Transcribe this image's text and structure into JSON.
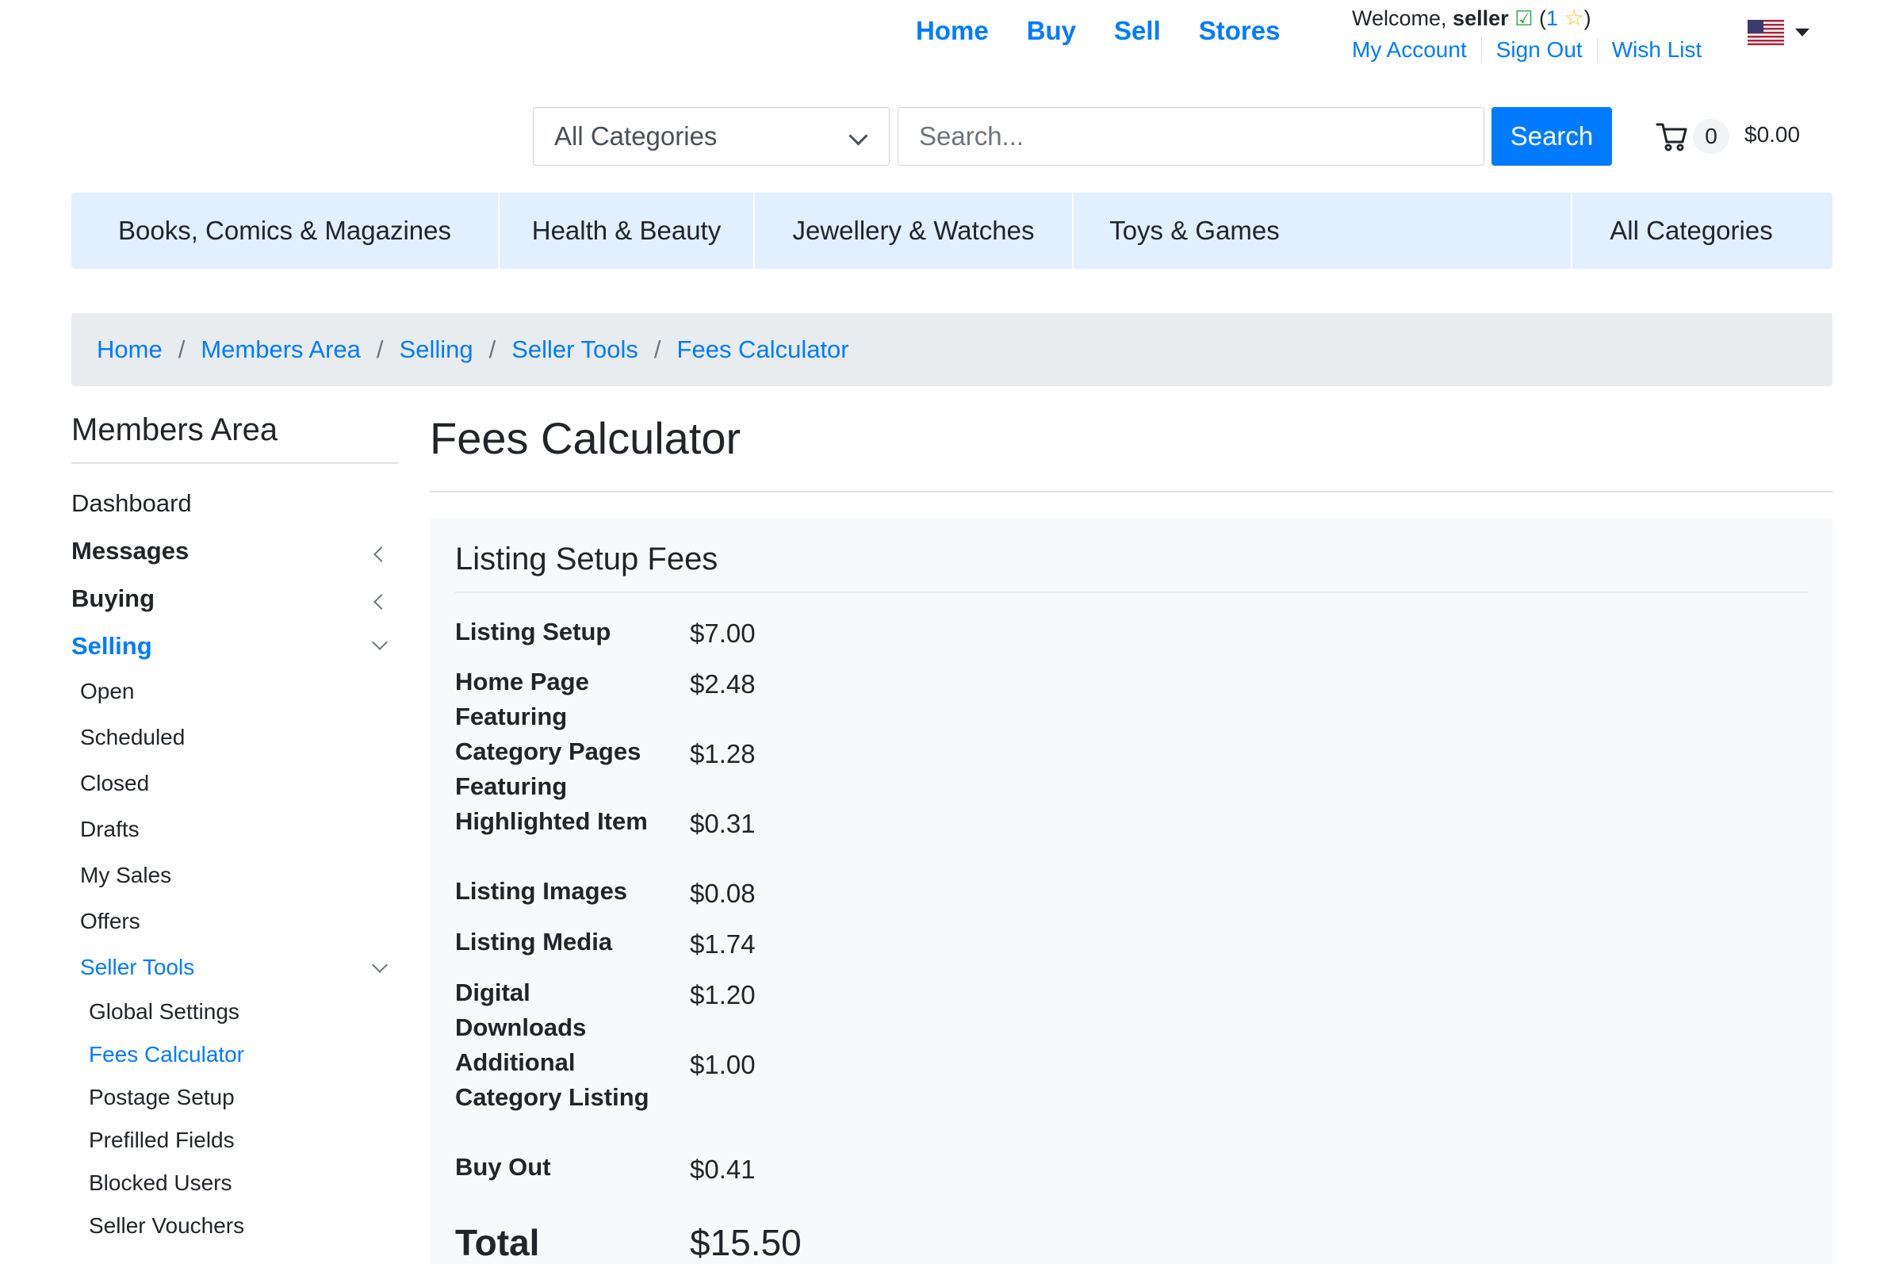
{
  "top_nav": [
    "Home",
    "Buy",
    "Sell",
    "Stores"
  ],
  "welcome": {
    "prefix": "Welcome, ",
    "username": "seller",
    "open_paren": "(",
    "rating": "1",
    "close_paren": ")"
  },
  "account_links": [
    "My Account",
    "Sign Out",
    "Wish List"
  ],
  "search": {
    "category": "All Categories",
    "placeholder": "Search...",
    "button": "Search"
  },
  "cart": {
    "count": "0",
    "total": "$0.00"
  },
  "category_bar": [
    "Books, Comics & Magazines",
    "Health & Beauty",
    "Jewellery & Watches",
    "Toys & Games",
    "All Categories"
  ],
  "breadcrumb": [
    "Home",
    "Members Area",
    "Selling",
    "Seller Tools",
    "Fees Calculator"
  ],
  "breadcrumb_separator": "/",
  "sidebar": {
    "title": "Members Area",
    "items": {
      "dashboard": "Dashboard",
      "messages": "Messages",
      "buying": "Buying",
      "selling": "Selling",
      "open": "Open",
      "scheduled": "Scheduled",
      "closed": "Closed",
      "drafts": "Drafts",
      "my_sales": "My Sales",
      "offers": "Offers",
      "seller_tools": "Seller Tools",
      "global_settings": "Global Settings",
      "fees_calculator": "Fees Calculator",
      "postage_setup": "Postage Setup",
      "prefilled_fields": "Prefilled Fields",
      "blocked_users": "Blocked Users",
      "seller_vouchers": "Seller Vouchers"
    }
  },
  "page": {
    "title": "Fees Calculator",
    "card_title": "Listing Setup Fees",
    "fees": [
      {
        "label": "Listing Setup",
        "value": "$7.00"
      },
      {
        "label": "Home Page Featuring",
        "value": "$2.48"
      },
      {
        "label": "Category Pages Featuring",
        "value": "$1.28"
      },
      {
        "label": "Highlighted Item",
        "value": "$0.31"
      },
      {
        "label": "Listing Images",
        "value": "$0.08"
      },
      {
        "label": "Listing Media",
        "value": "$1.74"
      },
      {
        "label": "Digital Downloads",
        "value": "$1.20"
      },
      {
        "label": "Additional Category Listing",
        "value": "$1.00"
      },
      {
        "label": "Buy Out",
        "value": "$0.41"
      }
    ],
    "total_label": "Total",
    "total_value": "$15.50"
  },
  "colors": {
    "link": "#007bff",
    "category_bar": "#e1efff",
    "breadcrumb_bg": "#e9ecef",
    "card_bg": "#f8f9fa"
  }
}
